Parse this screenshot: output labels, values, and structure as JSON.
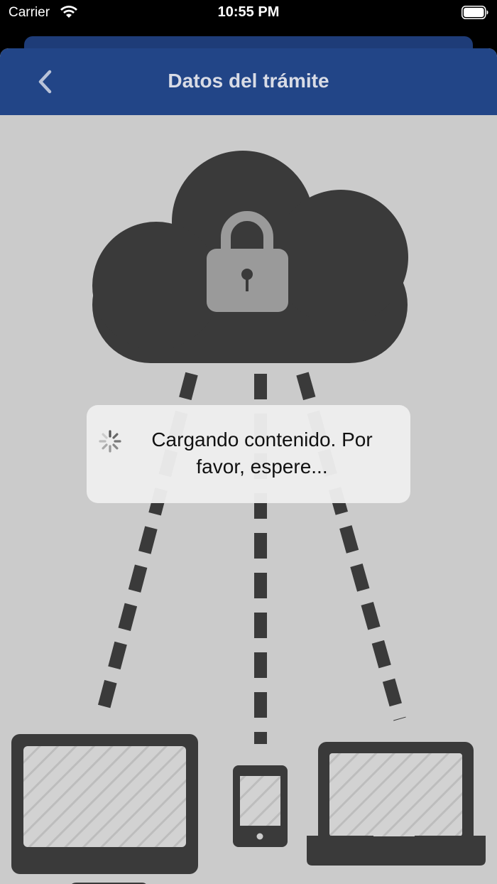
{
  "status_bar": {
    "carrier": "Carrier",
    "time": "10:55 PM",
    "icons": [
      "wifi-icon",
      "battery-icon"
    ]
  },
  "nav": {
    "title": "Datos del trámite",
    "back_icon": "chevron-left-icon"
  },
  "loading": {
    "message": "Cargando contenido. Por favor, espere...",
    "icon": "spinner-icon"
  },
  "illustration": {
    "elements": [
      "cloud-icon",
      "padlock-icon",
      "desktop-monitor-icon",
      "smartphone-icon",
      "laptop-icon"
    ]
  },
  "colors": {
    "nav_background": "#224587",
    "nav_title": "#d9dce6",
    "content_background": "#cbcbcb",
    "illustration_dark": "#3a3a3a",
    "illustration_gray": "#9a9a9a"
  }
}
